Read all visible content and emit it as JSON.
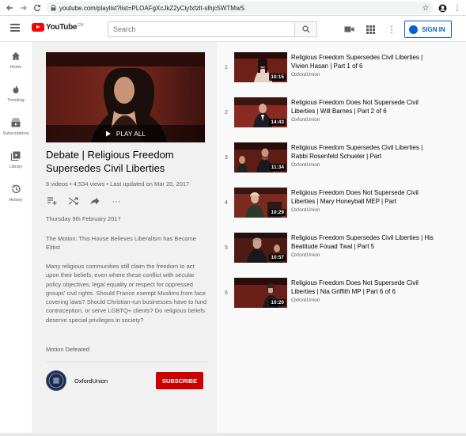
{
  "browser": {
    "url": "youtube.com/playlist?list=PLOAFgXcJkZ2yCiyfxfzlt-slhjc5WTMwS"
  },
  "header": {
    "logo_text": "YouTube",
    "logo_sup": "CH",
    "search_placeholder": "Search",
    "signin_label": "SIGN IN"
  },
  "sidebar": {
    "items": [
      {
        "label": "Home",
        "icon": "home-icon"
      },
      {
        "label": "Trending",
        "icon": "flame-icon"
      },
      {
        "label": "Subscriptions",
        "icon": "subscriptions-icon"
      },
      {
        "label": "Library",
        "icon": "library-icon"
      },
      {
        "label": "History",
        "icon": "history-icon"
      }
    ]
  },
  "playlist": {
    "play_all": "PLAY ALL",
    "title": "Debate | Religious Freedom Supersedes Civil Liberties",
    "stats": "6 videos • 4,534 views • Last updated on Mar 20, 2017",
    "date": "Thursday 9th February 2017",
    "motion": "The Motion: This House Believes Liberalism has Become Elitist",
    "description": "Many religious communities still claim the freedom to act upon their beliefs, even where these conflict with secular policy objectives, legal equality or respect for oppressed groups' civil rights.  Should France exempt Muslims from face covering laws?  Should Christian-run businesses have to fund contraception, or serve LGBTQ+ clients?  Do religious beliefs deserve special privileges in society?",
    "outcome": "Motion Defeated",
    "channel": "OxfordUnion",
    "subscribe_label": "SUBSCRIBE"
  },
  "videos": [
    {
      "index": "1",
      "title": "Religious Freedom Supersedes Civil Liberties | Vivien Hasan | Part 1 of 6",
      "channel": "OxfordUnion",
      "duration": "10:15"
    },
    {
      "index": "2",
      "title": "Religious Freedom Does Not Supersede Civil Liberties | Will Barnes | Part 2 of 6",
      "channel": "OxfordUnion",
      "duration": "14:43"
    },
    {
      "index": "3",
      "title": "Religious Freedom Supersedes Civil Liberties | Rabbi Rosenfeld Schueler | Part",
      "channel": "OxfordUnion",
      "duration": "11:34"
    },
    {
      "index": "4",
      "title": "Religious Freedom Does Not Supersede Civil Liberties | Mary Honeyball MEP | Part",
      "channel": "OxfordUnion",
      "duration": "10:29"
    },
    {
      "index": "5",
      "title": "Religious Freedom Supersedes Civil Liberties | His Beatitude Fouad Twal | Part 5",
      "channel": "OxfordUnion",
      "duration": "10:57"
    },
    {
      "index": "6",
      "title": "Religious Freedom Does Not Supersede Civil Liberties | Nia Griffith MP | Part 6 of 6",
      "channel": "OxfordUnion",
      "duration": "10:20"
    }
  ],
  "colors": {
    "brand_red": "#ff0000",
    "subscribe_red": "#cc0000",
    "link_blue": "#065fd4"
  }
}
